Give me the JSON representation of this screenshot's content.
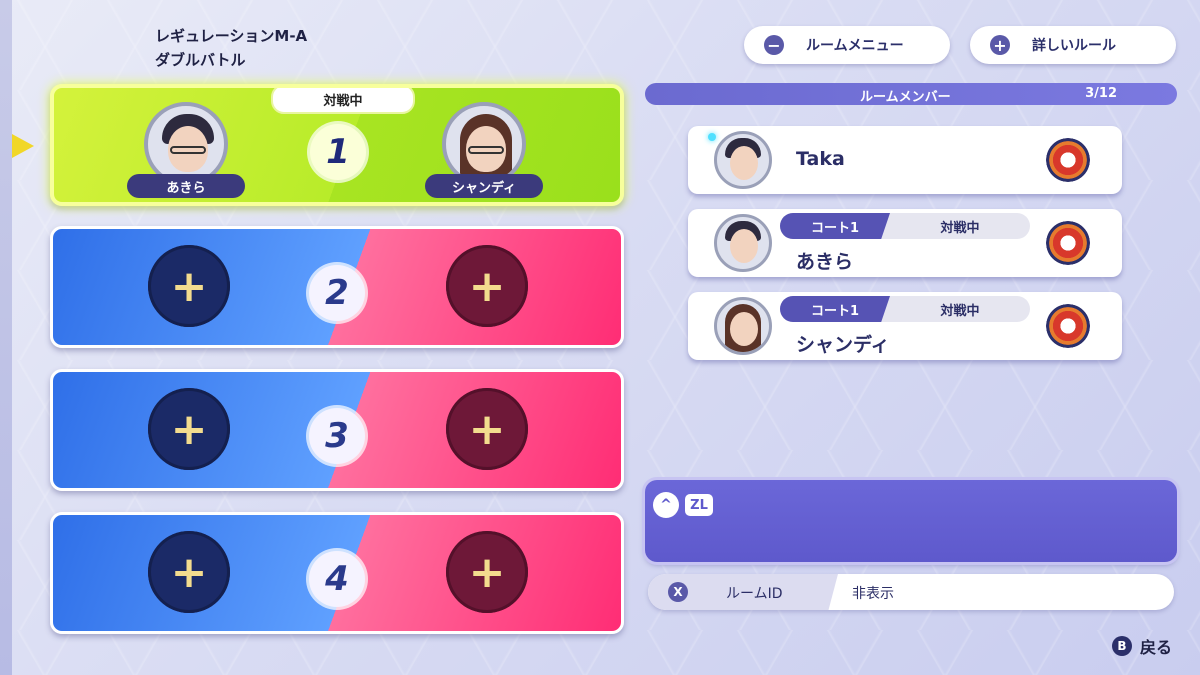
{
  "header": {
    "regulation": "レギュレーションM-A",
    "battle_type": "ダブルバトル"
  },
  "top_buttons": {
    "room_menu": "ルームメニュー",
    "details": "詳しいルール",
    "minus_symbol": "−",
    "plus_symbol": "+"
  },
  "courts": [
    {
      "number": "1",
      "status": "対戦中",
      "left_name": "あきら",
      "right_name": "シャンディ"
    },
    {
      "number": "2",
      "plus": "+"
    },
    {
      "number": "3",
      "plus": "+"
    },
    {
      "number": "4",
      "plus": "+"
    }
  ],
  "members_header": {
    "title": "ルームメンバー",
    "count": "3/12"
  },
  "members": [
    {
      "name": "Taka"
    },
    {
      "name": "あきら",
      "court": "コート1",
      "status": "対戦中"
    },
    {
      "name": "シャンディ",
      "court": "コート1",
      "status": "対戦中"
    }
  ],
  "chat": {
    "up_symbol": "^",
    "zl_label": "ZL"
  },
  "room_id": {
    "button": "X",
    "label": "ルームID",
    "value": "非表示"
  },
  "footer": {
    "b_button": "B",
    "back": "戻る"
  },
  "colors": {
    "accent": "#5e59cc",
    "active_court": "#b8ec2a",
    "blue_side": "#2f6fe8",
    "red_side": "#ff2d75",
    "selector": "#f1d728"
  }
}
